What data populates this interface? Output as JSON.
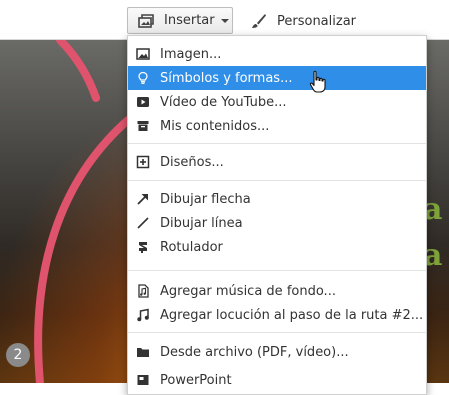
{
  "toolbar": {
    "insert_label": "Insertar",
    "customize_label": "Personalizar"
  },
  "menu": {
    "items": [
      {
        "label": "Imagen...",
        "icon": "image-icon"
      },
      {
        "label": "Símbolos y formas...",
        "icon": "lightbulb-icon",
        "highlighted": true
      },
      {
        "label": "Vídeo de YouTube...",
        "icon": "play-icon"
      },
      {
        "label": "Mis contenidos...",
        "icon": "archive-icon"
      },
      {
        "label": "Diseños...",
        "icon": "plus-box-icon"
      },
      {
        "label": "Dibujar flecha",
        "icon": "arrow-icon"
      },
      {
        "label": "Dibujar línea",
        "icon": "line-icon"
      },
      {
        "label": "Rotulador",
        "icon": "marker-icon"
      },
      {
        "label": "Agregar música de fondo...",
        "icon": "music-file-icon"
      },
      {
        "label": "Agregar locución al paso de la ruta #2...",
        "icon": "music-note-icon"
      },
      {
        "label": "Desde archivo (PDF, vídeo)...",
        "icon": "folder-icon"
      },
      {
        "label": "PowerPoint",
        "icon": "powerpoint-icon"
      }
    ]
  },
  "canvas": {
    "page_number": "2",
    "green_text_1": "a",
    "green_text_2": "a"
  },
  "colors": {
    "highlight": "#2f8ee8",
    "arc": "#e0536d",
    "green_text": "#7ea33a"
  }
}
